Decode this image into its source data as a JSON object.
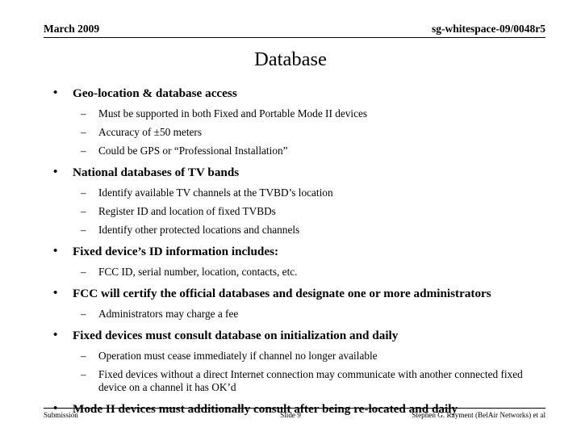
{
  "header": {
    "left": "March 2009",
    "right": "sg-whitespace-09/0048r5"
  },
  "title": "Database",
  "bullets": [
    {
      "text": "Geo-location & database access",
      "subs": [
        "Must be supported in both Fixed and Portable Mode II devices",
        "Accuracy of ±50 meters",
        "Could be GPS or “Professional Installation”"
      ]
    },
    {
      "text": "National databases of TV bands",
      "subs": [
        "Identify available TV channels at the TVBD’s location",
        "Register ID and location of fixed TVBDs",
        "Identify other protected locations and channels"
      ]
    },
    {
      "text": "Fixed device’s ID information includes:",
      "subs": [
        "FCC ID, serial number, location, contacts, etc."
      ]
    },
    {
      "text": "FCC will certify the official databases and designate one or more administrators",
      "subs": [
        "Administrators may charge a fee"
      ]
    },
    {
      "text": "Fixed devices must consult database on initialization and daily",
      "subs": [
        "Operation must cease immediately if channel no longer available",
        "Fixed devices without a direct Internet connection may communicate with another connected fixed device on a channel it has OK’d"
      ]
    },
    {
      "text": "Mode II devices must additionally consult after being re-located and daily",
      "subs": []
    }
  ],
  "bullet_glyph": "•",
  "dash_glyph": "–",
  "footer": {
    "left": "Submission",
    "center": "Slide 9",
    "right": "Stephen G. Rayment (BelAir Networks) et al"
  }
}
